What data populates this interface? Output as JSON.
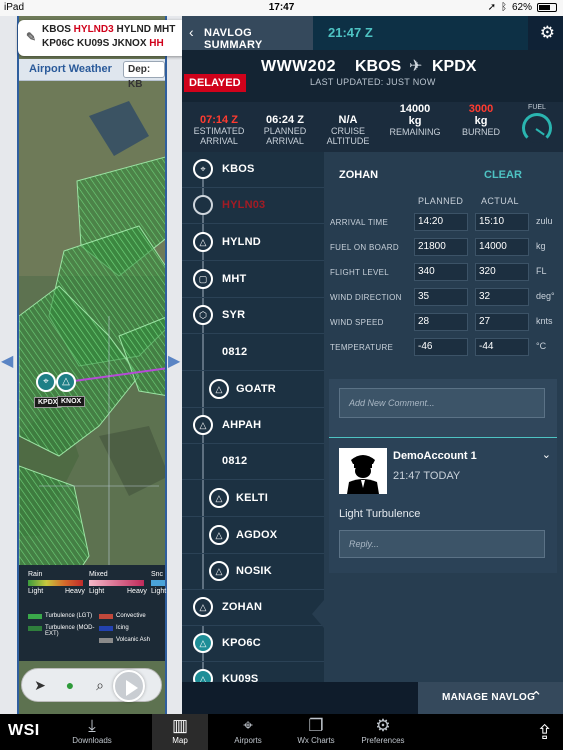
{
  "statusbar": {
    "device": "iPad",
    "time": "17:47",
    "battery": "62%"
  },
  "map": {
    "route_line1_black": "KBOS ",
    "route_line1_red": "HYLND3",
    "route_line1_rest": " HYLND MHT",
    "route_line2_black": "KP06C KU09S JKNOX ",
    "route_line2_red": "HH",
    "weather_label": "Airport Weather",
    "dep_button": "Dep: KB",
    "marker_labels": [
      "KPDX",
      "KNOX"
    ],
    "legend": {
      "rain": "Rain",
      "mixed": "Mixed",
      "snow": "Snc",
      "light": "Light",
      "heavy": "Heavy",
      "items": [
        "Turbulence (LGT)",
        "Convective",
        "Turbulence (MOD-EXT)",
        "Icing",
        "Volcanic Ash"
      ]
    }
  },
  "navlog": {
    "back_label": "NAVLOG SUMMARY",
    "time": "21:47 Z",
    "status_badge": "DELAYED",
    "flight_number": "WWW202",
    "origin": "KBOS",
    "destination": "KPDX",
    "last_updated": "LAST UPDATED: JUST NOW",
    "stats": [
      {
        "value": "07:14 Z",
        "label1": "ESTIMATED",
        "label2": "ARRIVAL",
        "color": "#ff3b30"
      },
      {
        "value": "06:24 Z",
        "label1": "PLANNED",
        "label2": "ARRIVAL",
        "color": "#ffffff"
      },
      {
        "value": "N/A",
        "label1": "CRUISE",
        "label2": "ALTITUDE",
        "color": "#ffffff"
      },
      {
        "value": "14000",
        "value2": "kg",
        "label1": "REMAINING",
        "color": "#ffffff"
      },
      {
        "value": "3000",
        "value2": "kg",
        "label1": "BURNED",
        "color": "#ff3b30"
      }
    ],
    "fuel_label": "FUEL",
    "waypoints": [
      {
        "name": "KBOS",
        "icon": "airport-icon"
      },
      {
        "name": "HYLN03",
        "icon": "circle-icon",
        "muted": true
      },
      {
        "name": "HYLND",
        "icon": "triangle-icon"
      },
      {
        "name": "MHT",
        "icon": "vor-icon"
      },
      {
        "name": "SYR",
        "icon": "vortac-icon"
      },
      {
        "name": "0812",
        "icon": "none"
      },
      {
        "name": "GOATR",
        "icon": "triangle-icon"
      },
      {
        "name": "AHPAH",
        "icon": "triangle-icon"
      },
      {
        "name": "0812",
        "icon": "none"
      },
      {
        "name": "KELTI",
        "icon": "triangle-icon"
      },
      {
        "name": "AGDOX",
        "icon": "triangle-icon"
      },
      {
        "name": "NOSIK",
        "icon": "triangle-icon"
      },
      {
        "name": "ZOHAN",
        "icon": "triangle-icon"
      },
      {
        "name": "KPO6C",
        "icon": "triangle-icon"
      },
      {
        "name": "KU09S",
        "icon": "triangle-icon"
      }
    ],
    "detail": {
      "waypoint": "ZOHAN",
      "clear_label": "CLEAR",
      "planned_header": "PLANNED",
      "actual_header": "ACTUAL",
      "fields": [
        {
          "label": "ARRIVAL TIME",
          "planned": "14:20",
          "actual": "15:10",
          "unit": "zulu"
        },
        {
          "label": "FUEL ON BOARD",
          "planned": "21800",
          "actual": "14000",
          "unit": "kg"
        },
        {
          "label": "FLIGHT LEVEL",
          "planned": "340",
          "actual": "320",
          "unit": "FL"
        },
        {
          "label": "WIND DIRECTION",
          "planned": "35",
          "actual": "32",
          "unit": "deg°"
        },
        {
          "label": "WIND SPEED",
          "planned": "28",
          "actual": "27",
          "unit": "knts"
        },
        {
          "label": "TEMPERATURE",
          "planned": "-46",
          "actual": "-44",
          "unit": "°C"
        }
      ],
      "comment_placeholder": "Add New Comment...",
      "post": {
        "user": "DemoAccount 1",
        "time": "21:47 TODAY",
        "text": "Light Turbulence",
        "reply_placeholder": "Reply..."
      }
    },
    "manage_label": "MANAGE NAVLOG"
  },
  "tabbar": {
    "logo": "WSI",
    "tabs": [
      {
        "label": "Downloads",
        "icon": "download-icon"
      },
      {
        "label": "Map",
        "icon": "map-icon",
        "active": true
      },
      {
        "label": "Airports",
        "icon": "airport-icon"
      },
      {
        "label": "Wx Charts",
        "icon": "charts-icon"
      },
      {
        "label": "Preferences",
        "icon": "gear-icon"
      }
    ]
  }
}
